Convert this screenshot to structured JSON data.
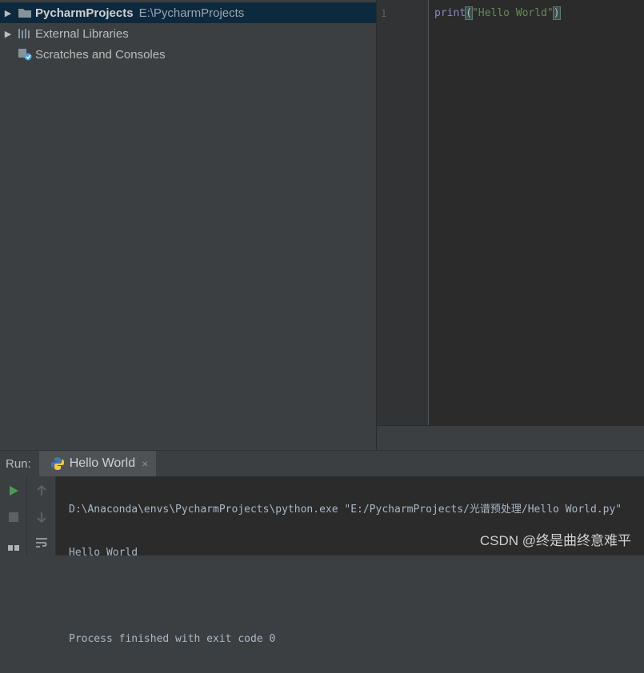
{
  "project_tree": {
    "items": [
      {
        "label": "PycharmProjects",
        "path": "E:\\PycharmProjects",
        "icon": "folder-icon",
        "expanded": false,
        "selected": true
      },
      {
        "label": "External Libraries",
        "icon": "libraries-icon",
        "expanded": false
      },
      {
        "label": "Scratches and Consoles",
        "icon": "scratches-icon"
      }
    ]
  },
  "editor": {
    "line_number": "1",
    "code": {
      "fn": "print",
      "open": "(",
      "string": "\"Hello World\"",
      "close": ")"
    }
  },
  "run": {
    "label": "Run:",
    "tab_label": "Hello World",
    "close_glyph": "×",
    "output": [
      "D:\\Anaconda\\envs\\PycharmProjects\\python.exe \"E:/PycharmProjects/光谱预处理/Hello World.py\"",
      "Hello World",
      "",
      "Process finished with exit code 0"
    ]
  },
  "watermark": "CSDN @终是曲终意难平",
  "colors": {
    "selection": "#0d293e",
    "run_green": "#499c54",
    "python_blue": "#3d7ab8",
    "python_yellow": "#f5c842"
  }
}
